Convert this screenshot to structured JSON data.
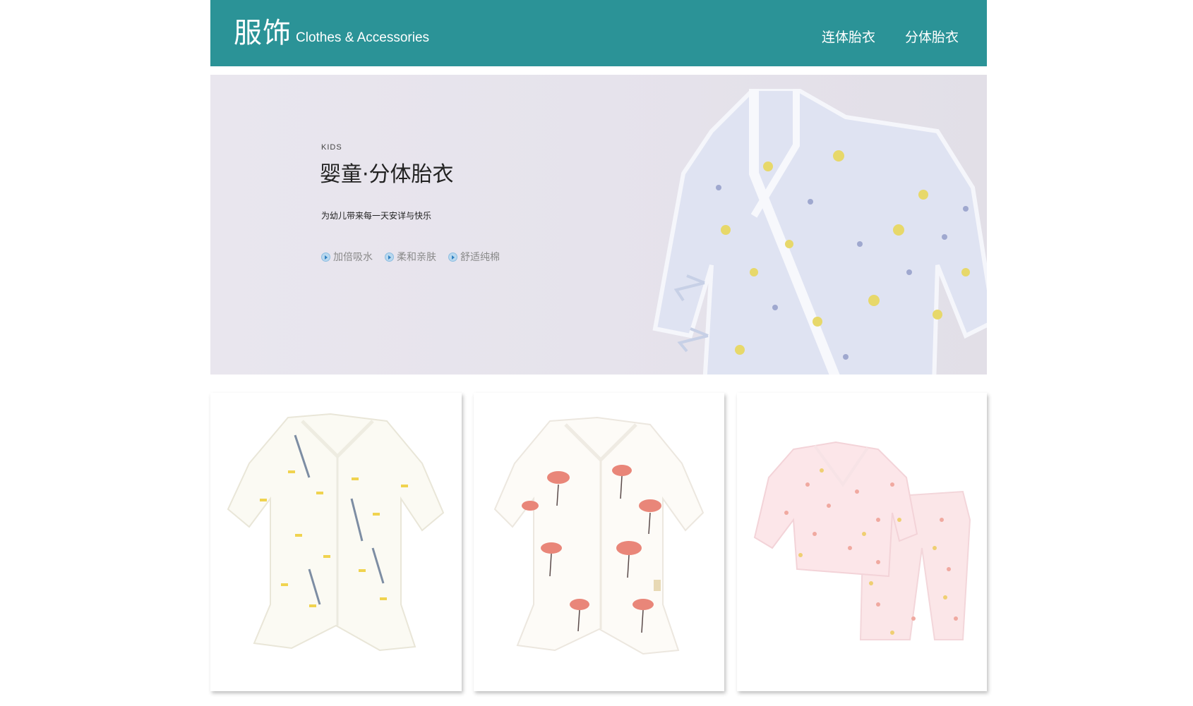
{
  "header": {
    "title_cn": "服饰",
    "title_en": "Clothes & Accessories",
    "nav": [
      {
        "label": "连体胎衣"
      },
      {
        "label": "分体胎衣"
      }
    ]
  },
  "banner": {
    "brand": "KIDS",
    "heading": "婴童·分体胎衣",
    "tagline": "为幼儿带来每一天安详与快乐",
    "features": [
      {
        "label": "加倍吸水"
      },
      {
        "label": "柔和亲肤"
      },
      {
        "label": "舒适纯棉"
      }
    ]
  },
  "colors": {
    "header_bg": "#2b9397",
    "banner_bg": "#e7e4ec",
    "feature_text": "#8a8a8a"
  },
  "products": [
    {
      "icon": "yellow-pattern-romper-image"
    },
    {
      "icon": "flamingo-pattern-romper-image"
    },
    {
      "icon": "pink-two-piece-set-image"
    }
  ]
}
